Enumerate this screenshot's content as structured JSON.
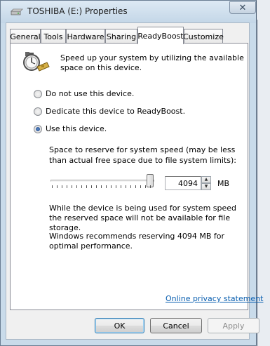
{
  "window": {
    "title": "TOSHIBA (E:) Properties",
    "close_glyph": "✕"
  },
  "tabs": [
    {
      "label": "General"
    },
    {
      "label": "Tools"
    },
    {
      "label": "Hardware"
    },
    {
      "label": "Sharing"
    },
    {
      "label": "ReadyBoost",
      "active": true
    },
    {
      "label": "Customize"
    }
  ],
  "intro": "Speed up your system by utilizing the available space on this device.",
  "options": [
    {
      "label": "Do not use this device.",
      "checked": false
    },
    {
      "label": "Dedicate this device to ReadyBoost.",
      "checked": false
    },
    {
      "label": "Use this device.",
      "checked": true
    }
  ],
  "space_label": "Space to reserve for system speed (may be less than actual free space due to file system limits):",
  "reserve": {
    "value": "4094",
    "unit": "MB",
    "slider_fraction": 1.0
  },
  "info_1": "While the device is being used for system speed the reserved space will not be available for file storage.",
  "info_2": "Windows recommends reserving 4094 MB for optimal performance.",
  "privacy_link": "Online privacy statement",
  "buttons": {
    "ok": "OK",
    "cancel": "Cancel",
    "apply": "Apply"
  },
  "icons": {
    "drive": "drive-icon",
    "readyboost": "stopwatch-icon",
    "close": "close-icon",
    "spin_up": "spin-up-icon",
    "spin_down": "spin-down-icon"
  }
}
